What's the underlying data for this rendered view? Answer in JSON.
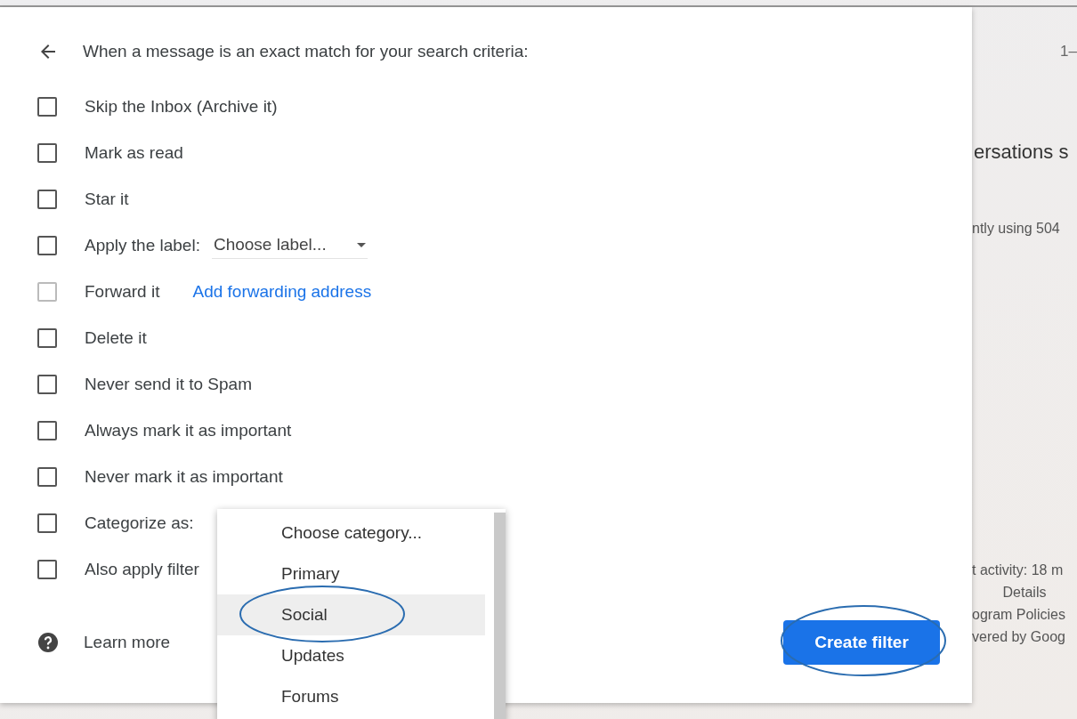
{
  "dialog": {
    "heading": "When a message is an exact match for your search criteria:",
    "options": [
      {
        "kind": "checkbox",
        "label": "Skip the Inbox (Archive it)",
        "checked": false,
        "disabled": false
      },
      {
        "kind": "checkbox",
        "label": "Mark as read",
        "checked": false,
        "disabled": false
      },
      {
        "kind": "checkbox",
        "label": "Star it",
        "checked": false,
        "disabled": false
      },
      {
        "kind": "select",
        "label": "Apply the label:",
        "value": "Choose label...",
        "checked": false,
        "disabled": false
      },
      {
        "kind": "link",
        "label": "Forward it",
        "link": "Add forwarding address",
        "checked": false,
        "disabled": true
      },
      {
        "kind": "checkbox",
        "label": "Delete it",
        "checked": false,
        "disabled": false
      },
      {
        "kind": "checkbox",
        "label": "Never send it to Spam",
        "checked": false,
        "disabled": false
      },
      {
        "kind": "checkbox",
        "label": "Always mark it as important",
        "checked": false,
        "disabled": false
      },
      {
        "kind": "checkbox",
        "label": "Never mark it as important",
        "checked": false,
        "disabled": false
      },
      {
        "kind": "checkbox",
        "label": "Categorize as:",
        "checked": false,
        "disabled": false
      },
      {
        "kind": "checkbox",
        "label": "Also apply filter",
        "checked": false,
        "disabled": false
      }
    ],
    "learn_more": "Learn more",
    "create_button": {
      "label": "Create filter",
      "circled": true
    }
  },
  "category_menu": {
    "items": [
      {
        "label": "Choose category...",
        "selected": false,
        "circled": false
      },
      {
        "label": "Primary",
        "selected": false,
        "circled": false
      },
      {
        "label": "Social",
        "selected": true,
        "circled": true
      },
      {
        "label": "Updates",
        "selected": false,
        "circled": false
      },
      {
        "label": "Forums",
        "selected": false,
        "circled": false
      }
    ]
  },
  "background": {
    "top_text": "1–",
    "heading": "ersations s",
    "storage": "ntly using 504",
    "footer": [
      "t activity: 18 m",
      "Details",
      "ogram Policies",
      "vered by Goog"
    ]
  }
}
